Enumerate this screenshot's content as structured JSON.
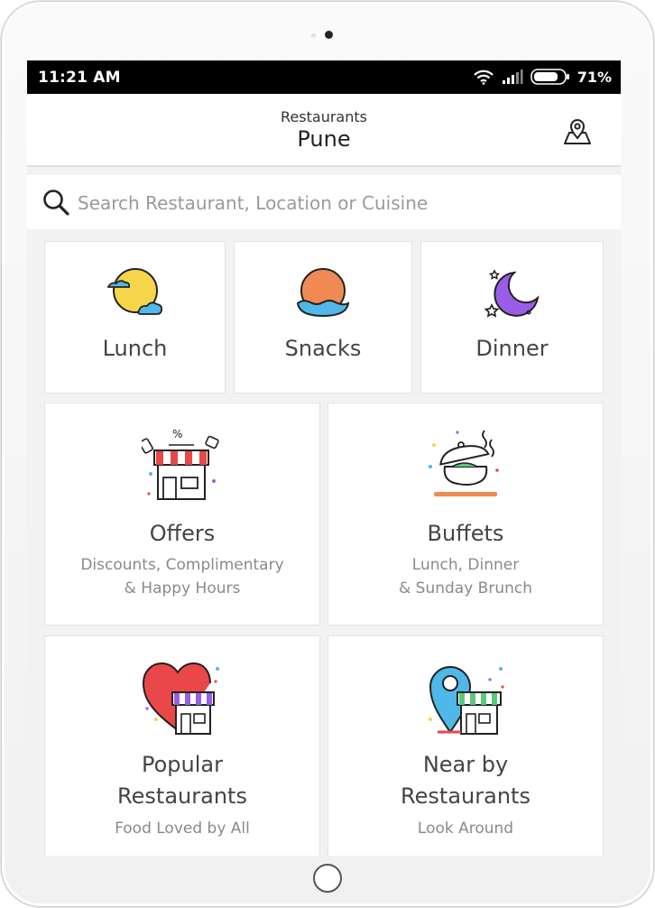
{
  "status_bar": {
    "time": "11:21 AM",
    "battery": "71%"
  },
  "header": {
    "label": "Restaurants",
    "city": "Pune"
  },
  "search": {
    "placeholder": "Search Restaurant, Location or Cuisine"
  },
  "meals": [
    {
      "title": "Lunch",
      "icon": "sun-cloud-icon"
    },
    {
      "title": "Snacks",
      "icon": "sunset-icon"
    },
    {
      "title": "Dinner",
      "icon": "moon-stars-icon"
    }
  ],
  "categories": [
    {
      "title": "Offers",
      "sub1": "Discounts, Complimentary",
      "sub2": "& Happy Hours",
      "icon": "offers-shop-icon"
    },
    {
      "title": "Buffets",
      "sub1": "Lunch, Dinner",
      "sub2": "& Sunday Brunch",
      "icon": "buffet-pot-icon"
    },
    {
      "title1": "Popular",
      "title2": "Restaurants",
      "sub": "Food Loved by All",
      "icon": "heart-shop-icon"
    },
    {
      "title1": "Near by",
      "title2": "Restaurants",
      "sub": "Look Around",
      "icon": "location-shop-icon"
    }
  ],
  "colors": {
    "status_bar": "#000000",
    "background": "#f2f2f2",
    "card": "#ffffff",
    "accent_yellow": "#f7d54a",
    "accent_orange": "#f08a55",
    "accent_blue": "#4fb8e8",
    "accent_purple": "#9b5de5",
    "accent_red": "#ea4848"
  }
}
